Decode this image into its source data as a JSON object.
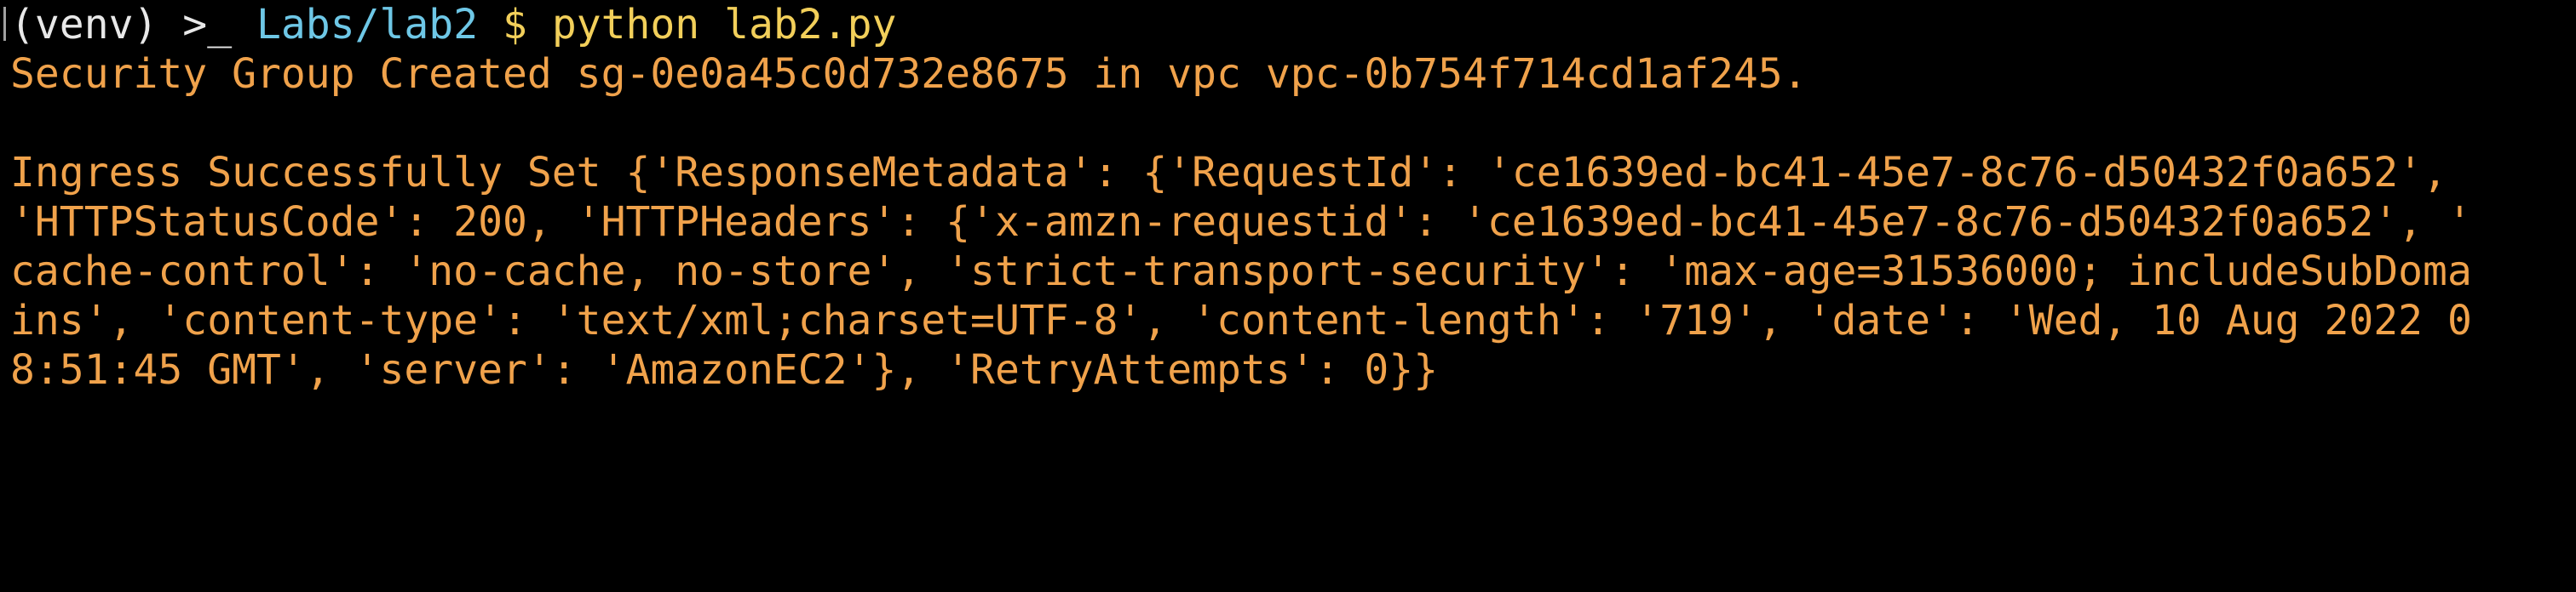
{
  "colors": {
    "background": "#000000",
    "prompt_text": "#e8e8e8",
    "path": "#6ec7e6",
    "command": "#f2cf5a",
    "output": "#f0a24b"
  },
  "prompt": {
    "venv": "(venv)",
    "symbol": ">_",
    "path": "Labs/lab2",
    "dollar": "$",
    "command": "python lab2.py"
  },
  "output_lines": [
    "Security Group Created sg-0e0a45c0d732e8675 in vpc vpc-0b754f714cd1af245.",
    "Ingress Successfully Set {'ResponseMetadata': {'RequestId': 'ce1639ed-bc41-45e7-8c76-d50432f0a652',",
    "'HTTPStatusCode': 200, 'HTTPHeaders': {'x-amzn-requestid': 'ce1639ed-bc41-45e7-8c76-d50432f0a652', '",
    "cache-control': 'no-cache, no-store', 'strict-transport-security': 'max-age=31536000; includeSubDoma",
    "ins', 'content-type': 'text/xml;charset=UTF-8', 'content-length': '719', 'date': 'Wed, 10 Aug 2022 0",
    "8:51:45 GMT', 'server': 'AmazonEC2'}, 'RetryAttempts': 0}}"
  ]
}
